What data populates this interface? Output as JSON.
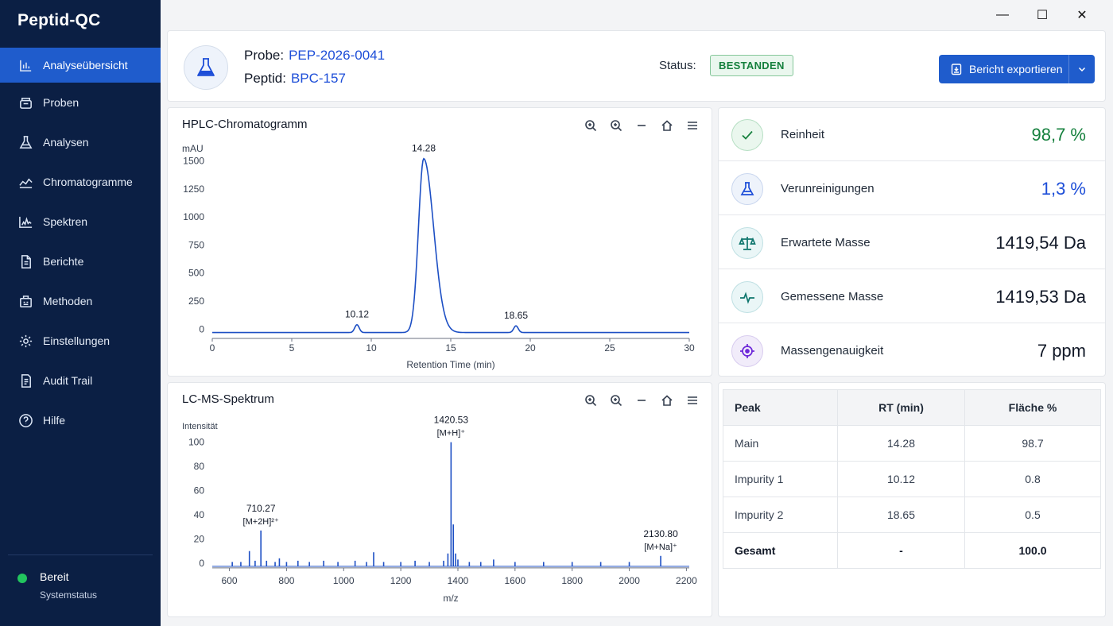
{
  "app": {
    "title": "Peptid-QC"
  },
  "sidebar": {
    "items": [
      {
        "label": "Analyseübersicht",
        "icon": "bar-chart-icon",
        "active": true
      },
      {
        "label": "Proben",
        "icon": "sample-box-icon"
      },
      {
        "label": "Analysen",
        "icon": "flask-icon"
      },
      {
        "label": "Chromatogramme",
        "icon": "line-chart-icon"
      },
      {
        "label": "Spektren",
        "icon": "spectrum-icon"
      },
      {
        "label": "Berichte",
        "icon": "document-icon"
      },
      {
        "label": "Methoden",
        "icon": "methods-icon"
      },
      {
        "label": "Einstellungen",
        "icon": "gear-icon"
      },
      {
        "label": "Audit Trail",
        "icon": "audit-icon"
      },
      {
        "label": "Hilfe",
        "icon": "help-icon"
      }
    ],
    "status": {
      "label": "Bereit",
      "sub": "Systemstatus",
      "color": "#22c55e"
    }
  },
  "window": {
    "minimize": "—",
    "maximize": "☐",
    "close": "✕"
  },
  "header": {
    "probe_label": "Probe:",
    "probe_value": "PEP-2026-0041",
    "peptid_label": "Peptid:",
    "peptid_value": "BPC-157",
    "status_label": "Status:",
    "status_value": "BESTANDEN",
    "export_label": "Bericht exportieren"
  },
  "hplc": {
    "title": "HPLC-Chromatogramm",
    "chart_data": {
      "type": "line",
      "ylabel": "mAU",
      "xlabel": "Retention Time (min)",
      "xlim": [
        0,
        30
      ],
      "ylim": [
        -40,
        1560
      ],
      "xticks": [
        0,
        5,
        10,
        15,
        20,
        25,
        30
      ],
      "yticks": [
        0,
        250,
        500,
        750,
        1000,
        1250,
        1500
      ],
      "peaks": [
        {
          "rt": 9.1,
          "height": 70,
          "width": 0.14,
          "label": "10.12"
        },
        {
          "rt": 13.3,
          "height": 1550,
          "width": 0.33,
          "tail": 0.62,
          "label": "14.28"
        },
        {
          "rt": 19.1,
          "height": 60,
          "width": 0.14,
          "label": "18.65"
        }
      ],
      "baseline": -30
    }
  },
  "lcms": {
    "title": "LC-MS-Spektrum",
    "chart_data": {
      "type": "bar",
      "ylabel": "Intensität",
      "xlabel": "m/z",
      "xlim": [
        540,
        2210
      ],
      "ylim": [
        -4,
        103
      ],
      "xticks": [
        600,
        800,
        1000,
        1200,
        1400,
        1600,
        1800,
        2000,
        2200
      ],
      "yticks": [
        0,
        20,
        40,
        60,
        80,
        100
      ],
      "peaks": [
        {
          "mz": 610,
          "i": 1
        },
        {
          "mz": 640,
          "i": 1
        },
        {
          "mz": 670,
          "i": 10
        },
        {
          "mz": 690,
          "i": 2
        },
        {
          "mz": 710.27,
          "i": 27,
          "label1": "710.27",
          "label2": "[M+2H]²⁺"
        },
        {
          "mz": 730,
          "i": 2
        },
        {
          "mz": 760,
          "i": 1
        },
        {
          "mz": 775,
          "i": 4
        },
        {
          "mz": 800,
          "i": 1
        },
        {
          "mz": 840,
          "i": 2
        },
        {
          "mz": 880,
          "i": 1
        },
        {
          "mz": 930,
          "i": 2
        },
        {
          "mz": 980,
          "i": 1
        },
        {
          "mz": 1040,
          "i": 2
        },
        {
          "mz": 1080,
          "i": 1
        },
        {
          "mz": 1105,
          "i": 9
        },
        {
          "mz": 1140,
          "i": 1
        },
        {
          "mz": 1200,
          "i": 1
        },
        {
          "mz": 1250,
          "i": 2
        },
        {
          "mz": 1300,
          "i": 1
        },
        {
          "mz": 1350,
          "i": 2
        },
        {
          "mz": 1365,
          "i": 8
        },
        {
          "mz": 1376,
          "i": 100,
          "label1": "1420.53",
          "label2": "[M+H]⁺"
        },
        {
          "mz": 1384,
          "i": 32
        },
        {
          "mz": 1392,
          "i": 8
        },
        {
          "mz": 1400,
          "i": 3
        },
        {
          "mz": 1440,
          "i": 1
        },
        {
          "mz": 1480,
          "i": 1
        },
        {
          "mz": 1525,
          "i": 3
        },
        {
          "mz": 1600,
          "i": 1
        },
        {
          "mz": 1700,
          "i": 1
        },
        {
          "mz": 1800,
          "i": 1
        },
        {
          "mz": 1900,
          "i": 1
        },
        {
          "mz": 2000,
          "i": 1
        },
        {
          "mz": 2110,
          "i": 6,
          "label1": "2130.80",
          "label2": "[M+Na]⁺"
        }
      ]
    }
  },
  "metrics": [
    {
      "label": "Reinheit",
      "value": "98,7 %",
      "icon": "check-icon",
      "color": "#15803d",
      "bg": "#eaf7ee",
      "border": "#b6dfc3"
    },
    {
      "label": "Verunreinigungen",
      "value": "1,3 %",
      "icon": "flask-icon",
      "color": "#1d4ed8",
      "bg": "#eef3fb",
      "border": "#c9d6ee"
    },
    {
      "label": "Erwartete Masse",
      "value": "1419,54 Da",
      "icon": "scale-icon",
      "color": "#111827",
      "bg": "#eaf6f7",
      "border": "#bfe0e3"
    },
    {
      "label": "Gemessene Masse",
      "value": "1419,53 Da",
      "icon": "pulse-icon",
      "color": "#111827",
      "bg": "#eaf6f7",
      "border": "#bfe0e3"
    },
    {
      "label": "Massengenauigkeit",
      "value": "7 ppm",
      "icon": "target-icon",
      "color": "#111827",
      "bg": "#f1ecfa",
      "border": "#d8ccef"
    }
  ],
  "table": {
    "headers": [
      "Peak",
      "RT (min)",
      "Fläche %"
    ],
    "rows": [
      [
        "Main",
        "14.28",
        "98.7"
      ],
      [
        "Impurity 1",
        "10.12",
        "0.8"
      ],
      [
        "Impurity 2",
        "18.65",
        "0.5"
      ],
      [
        "Gesamt",
        "-",
        "100.0"
      ]
    ]
  },
  "colors": {
    "accent": "#1f5ccc",
    "sidebar": "#0b1f44",
    "trace": "#1d4fc4"
  }
}
